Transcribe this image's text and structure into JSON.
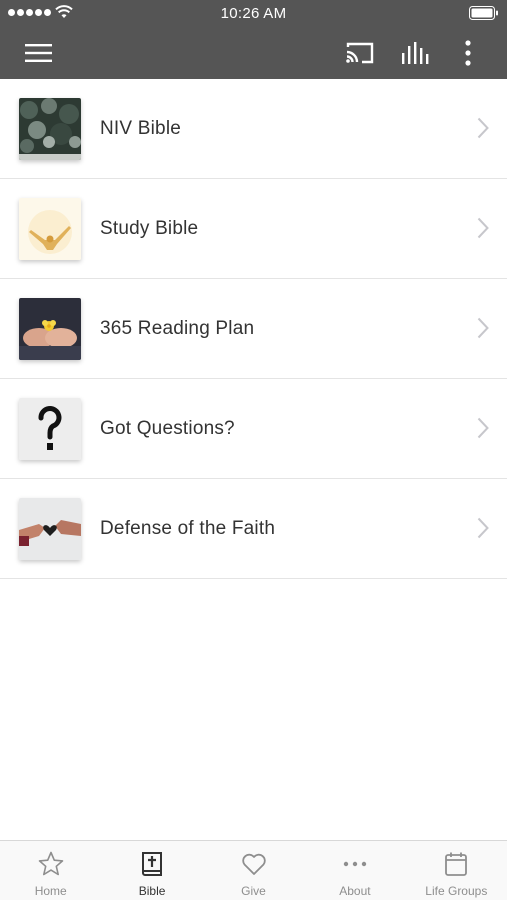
{
  "status_bar": {
    "time": "10:26 AM"
  },
  "app_bar": {
    "icons": [
      "menu-icon",
      "cast-icon",
      "equalizer-icon",
      "more-vertical-icon"
    ]
  },
  "list": {
    "items": [
      {
        "label": "NIV Bible",
        "thumb": "forest-thumbnail"
      },
      {
        "label": "Study Bible",
        "thumb": "raised-arms-thumbnail"
      },
      {
        "label": "365 Reading Plan",
        "thumb": "open-hands-flower-thumbnail"
      },
      {
        "label": "Got Questions?",
        "thumb": "question-mark-thumbnail"
      },
      {
        "label": "Defense of the Faith",
        "thumb": "hands-heart-thumbnail"
      }
    ]
  },
  "tab_bar": {
    "active": "Bible",
    "tabs": [
      {
        "label": "Home",
        "icon": "star-icon"
      },
      {
        "label": "Bible",
        "icon": "bible-icon"
      },
      {
        "label": "Give",
        "icon": "heart-icon"
      },
      {
        "label": "About",
        "icon": "ellipsis-icon"
      },
      {
        "label": "Life Groups",
        "icon": "calendar-icon"
      }
    ]
  },
  "colors": {
    "header": "#555555",
    "text": "#333333",
    "tab_inactive": "#8e8e8e",
    "divider": "#e4e4e4"
  }
}
